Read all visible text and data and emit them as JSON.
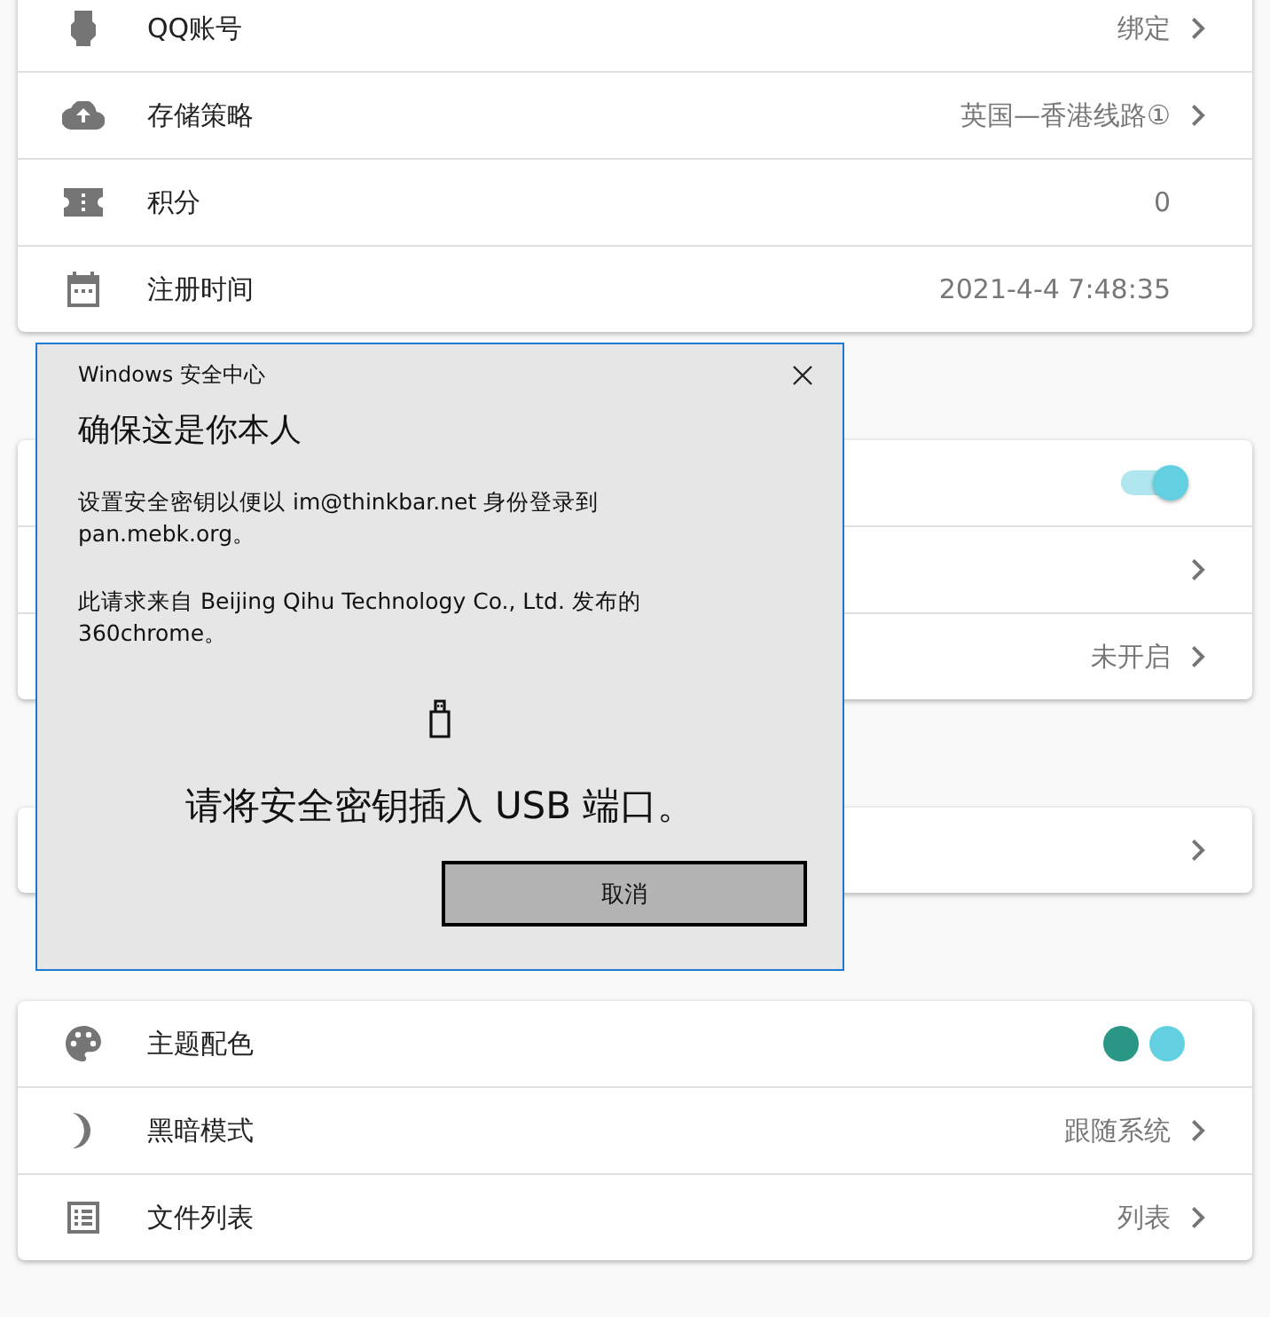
{
  "sections": [
    {
      "rows": [
        {
          "kind": "text",
          "label": "QQ账号",
          "value": "绑定",
          "chevron": true
        },
        {
          "kind": "text",
          "label": "存储策略",
          "value": "英国—香港线路①",
          "chevron": true
        },
        {
          "kind": "text",
          "label": "积分",
          "value": "0",
          "chevron": false
        },
        {
          "kind": "text",
          "label": "注册时间",
          "value": "2021-4-4 7:48:35",
          "chevron": false
        }
      ]
    },
    {
      "rows": [
        {
          "kind": "toggle",
          "on": true
        },
        {
          "kind": "text",
          "chevron": true
        },
        {
          "kind": "text",
          "value": "未开启",
          "chevron": true
        }
      ]
    },
    {
      "rows": [
        {
          "kind": "text",
          "chevron": true
        }
      ]
    },
    {
      "rows": [
        {
          "kind": "colors",
          "label": "主题配色",
          "colors": [
            {
              "color": "#2a9686"
            },
            {
              "color": "#63d0e1"
            }
          ]
        },
        {
          "kind": "text",
          "label": "黑暗模式",
          "value": "跟随系统",
          "chevron": true
        },
        {
          "kind": "text",
          "label": "文件列表",
          "value": "列表",
          "chevron": true
        }
      ]
    }
  ],
  "dialog": {
    "title": "Windows 安全中心",
    "heading": "确保这是你本人",
    "paragraphs": [
      "设置安全密钥以便以 im@thinkbar.net 身份登录到 pan.mebk.org。",
      "此请求来自 Beijing Qihu Technology Co., Ltd. 发布的 360chrome。"
    ],
    "prompt": "请将安全密钥插入 USB 端口。",
    "button": "取消"
  }
}
